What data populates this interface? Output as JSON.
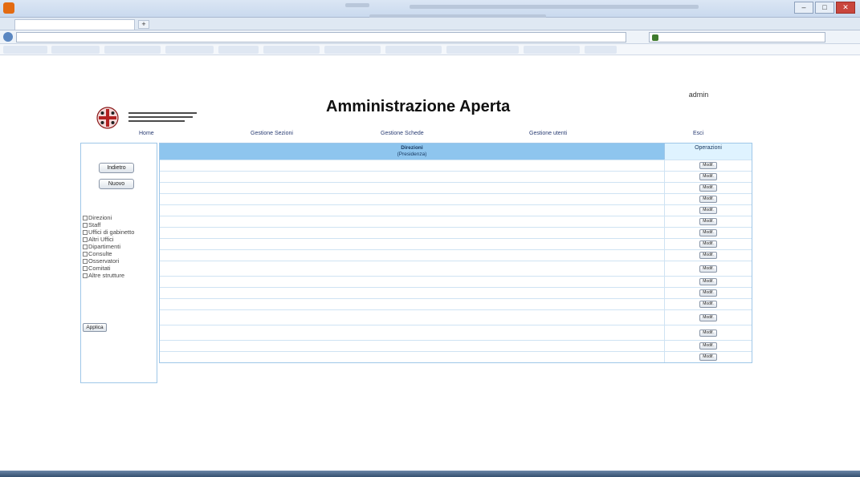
{
  "browser": {
    "window_title": "",
    "tab_label": "",
    "url": "",
    "search_placeholder": "",
    "controls": {
      "minimize": "–",
      "maximize": "□",
      "close": "✕"
    },
    "add_tab": "+"
  },
  "header": {
    "site_title": "Amministrazione Aperta",
    "user": {
      "name": "admin",
      "role": "",
      "logout": "",
      "version": ""
    }
  },
  "menu": [
    "Home",
    "Gestione Sezioni",
    "Gestione Schede",
    "Gestione utenti",
    "Esci"
  ],
  "sidebar": {
    "btn_indietro": "Indietro",
    "btn_nuovo": "Nuovo",
    "filters": [
      "Direzioni",
      "Staff",
      "Uffici di gabinetto",
      "Altri Uffici",
      "Dipartimenti",
      "Consulte",
      "Osservatori",
      "Comitati",
      "Altre strutture"
    ],
    "apply": "Applica"
  },
  "table": {
    "header_title": "Direzioni",
    "header_subtitle": "(Presidenza)",
    "ops_header": "Operazioni",
    "modify_label": "Modif.",
    "rows": [
      {
        "name": "",
        "note": ""
      },
      {
        "name": "",
        "note": ""
      },
      {
        "name": "",
        "note": ""
      },
      {
        "name": "",
        "note": ""
      },
      {
        "name": "",
        "note": ""
      },
      {
        "name": "",
        "note": ""
      },
      {
        "name": "",
        "note": ""
      },
      {
        "name": "",
        "note": ""
      },
      {
        "name": "",
        "note": ""
      },
      {
        "name": "",
        "note": ""
      },
      {
        "name": "",
        "note": ""
      },
      {
        "name": "",
        "note": ""
      },
      {
        "name": "",
        "note": ""
      },
      {
        "name": "",
        "note": ""
      },
      {
        "name": "",
        "note": ""
      },
      {
        "name": "",
        "note": ""
      },
      {
        "name": "",
        "note": ""
      }
    ]
  }
}
